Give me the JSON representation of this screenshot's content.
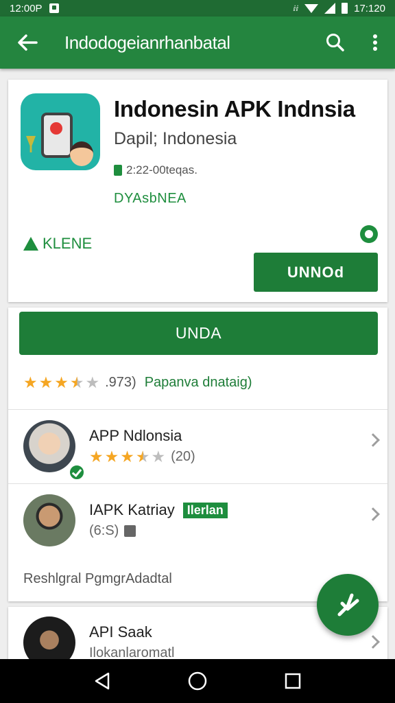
{
  "status_bar": {
    "time_left": "12:00P",
    "time_right": "17:120",
    "glyph": "ⅈⅈ"
  },
  "toolbar": {
    "title": "Indodogeianrhanbatal",
    "icons": [
      "back-arrow-icon",
      "search-icon",
      "overflow-menu-icon"
    ]
  },
  "app": {
    "title": "Indonesin APK Indnsia",
    "developer": "Dapil; Indonesia",
    "meta": "2:22-00teqas.",
    "tag": "DYAsbNEA",
    "install_status": "KLENE",
    "secondary_button": "UNNOd"
  },
  "main": {
    "primary_button": "UNDA",
    "rating": {
      "stars": 3.5,
      "count": ".973)",
      "link": "Papanva dnataig)"
    }
  },
  "reviews": [
    {
      "name": "APP Ndlonsia",
      "stars": 3.5,
      "sub": "(20)"
    },
    {
      "name": "IAPK Katriay",
      "badge": "Ilerlan",
      "sub": "(6:S)"
    },
    {
      "name": "API Saak",
      "sub": "Ilokanlaromatl"
    }
  ],
  "footer_text": "Reshlgral PgmgrAdadtal",
  "colors": {
    "primary": "#24853f",
    "button": "#1e7d38",
    "star": "#f5a623"
  }
}
